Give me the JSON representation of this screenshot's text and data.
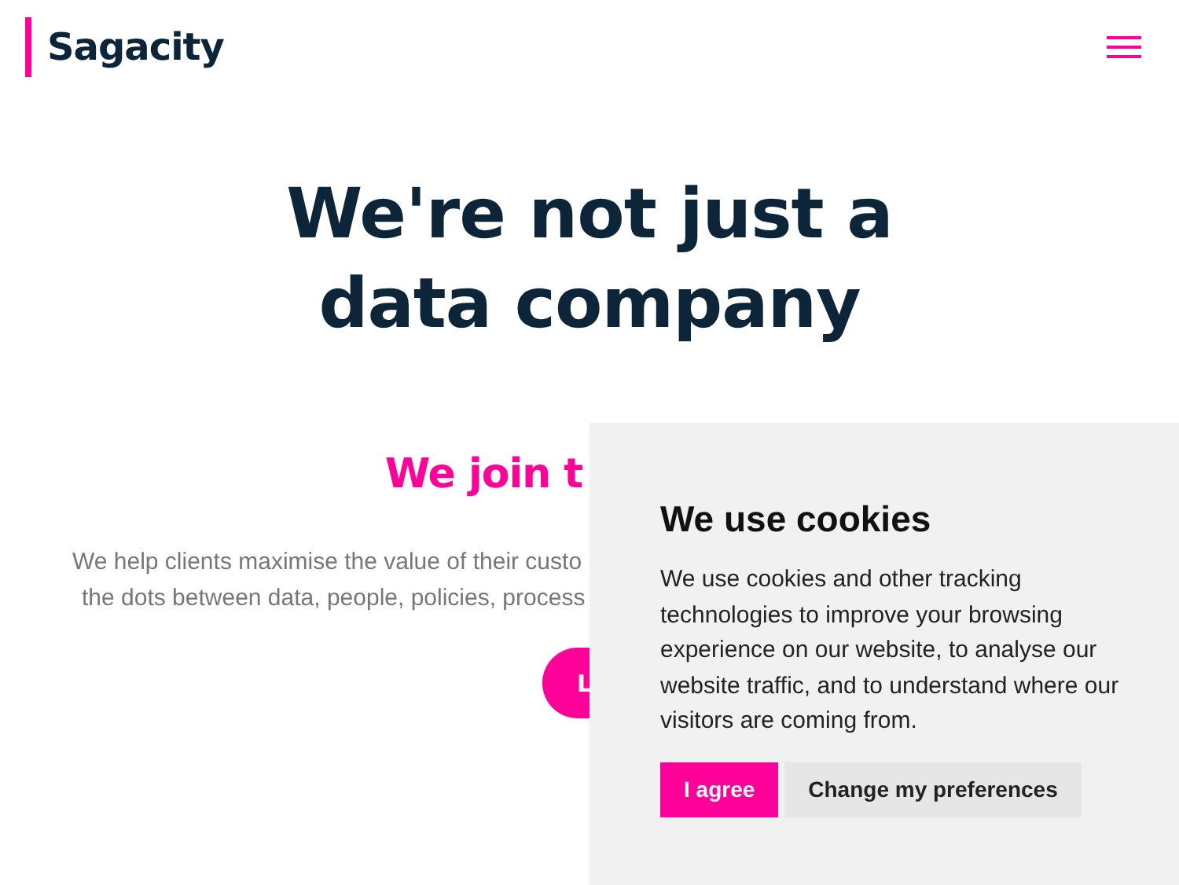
{
  "header": {
    "logo": "Sagacity"
  },
  "hero": {
    "title_lines": [
      "We're not just a",
      "data company"
    ],
    "subtitle": "We join t",
    "body_lines": [
      "We help clients maximise the value of their custo",
      "the dots between data, people, policies, process"
    ],
    "button": "L"
  },
  "cookie_banner": {
    "title": "We use cookies",
    "text": "We use cookies and other tracking technologies to improve your browsing experience on our website, to analyse our website traffic, and to understand where our visitors are coming from.",
    "buttons": [
      {
        "label": "I agree",
        "kind": "primary"
      },
      {
        "label": "Change my preferences",
        "kind": "secondary"
      }
    ]
  }
}
